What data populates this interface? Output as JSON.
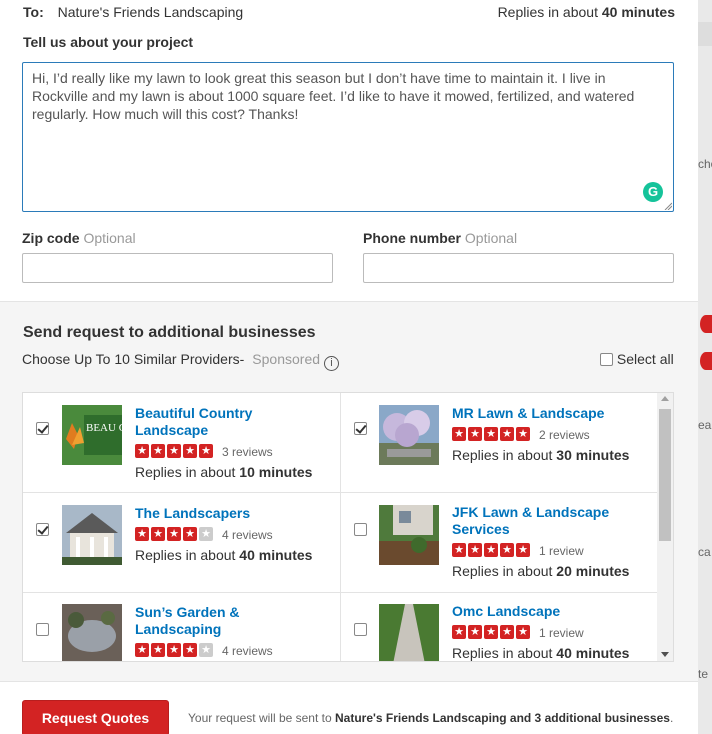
{
  "header": {
    "to_label": "To:",
    "business": "Nature's Friends Landscaping",
    "replies_prefix": "Replies in about",
    "replies_time": "40 minutes"
  },
  "project": {
    "label": "Tell us about your project",
    "text": "Hi, I’d really like my lawn to look great this season but I don’t have time to maintain it. I live in Rockville and my lawn is about 1000 square feet. I’d like to have it mowed, fertilized, and watered regularly. How much will this cost? Thanks!"
  },
  "zip": {
    "label": "Zip code",
    "optional": "Optional",
    "value": ""
  },
  "phone": {
    "label": "Phone number",
    "optional": "Optional",
    "value": ""
  },
  "additional": {
    "title": "Send request to additional businesses",
    "subtitle": "Choose Up To 10 Similar Providers",
    "separator": "-",
    "sponsored": "Sponsored",
    "info_icon": "i",
    "select_all": "Select all",
    "providers": [
      {
        "name": "Beautiful Country Landscape",
        "rating": 5,
        "reviews": "3 reviews",
        "replies_prefix": "Replies in about",
        "replies_time": "10 minutes",
        "checked": true,
        "thumb_logo": "BEAU COUN"
      },
      {
        "name": "MR Lawn & Landscape",
        "rating": 5,
        "reviews": "2 reviews",
        "replies_prefix": "Replies in about",
        "replies_time": "30 minutes",
        "checked": true
      },
      {
        "name": "The Landscapers",
        "rating": 4,
        "reviews": "4 reviews",
        "replies_prefix": "Replies in about",
        "replies_time": "40 minutes",
        "checked": true
      },
      {
        "name": "JFK Lawn & Landscape Services",
        "rating": 5,
        "reviews": "1 review",
        "replies_prefix": "Replies in about",
        "replies_time": "20 minutes",
        "checked": false
      },
      {
        "name": "Sun’s Garden & Landscaping",
        "rating": 4,
        "reviews": "4 reviews",
        "replies_prefix": "",
        "replies_time": "",
        "checked": false
      },
      {
        "name": "Omc Landscape",
        "rating": 5,
        "reviews": "1 review",
        "replies_prefix": "Replies in about",
        "replies_time": "40 minutes",
        "checked": false
      }
    ]
  },
  "footer": {
    "button": "Request Quotes",
    "note_prefix": "Your request will be sent to",
    "note_business": "Nature's Friends Landscaping and 3 additional businesses",
    "note_suffix": "."
  },
  "background_fragments": [
    "cho",
    "ea",
    "ca",
    "te"
  ],
  "colors": {
    "accent": "#d32323",
    "link": "#0073bb",
    "focus": "#2b7bb9",
    "grammarly": "#15c39a"
  }
}
